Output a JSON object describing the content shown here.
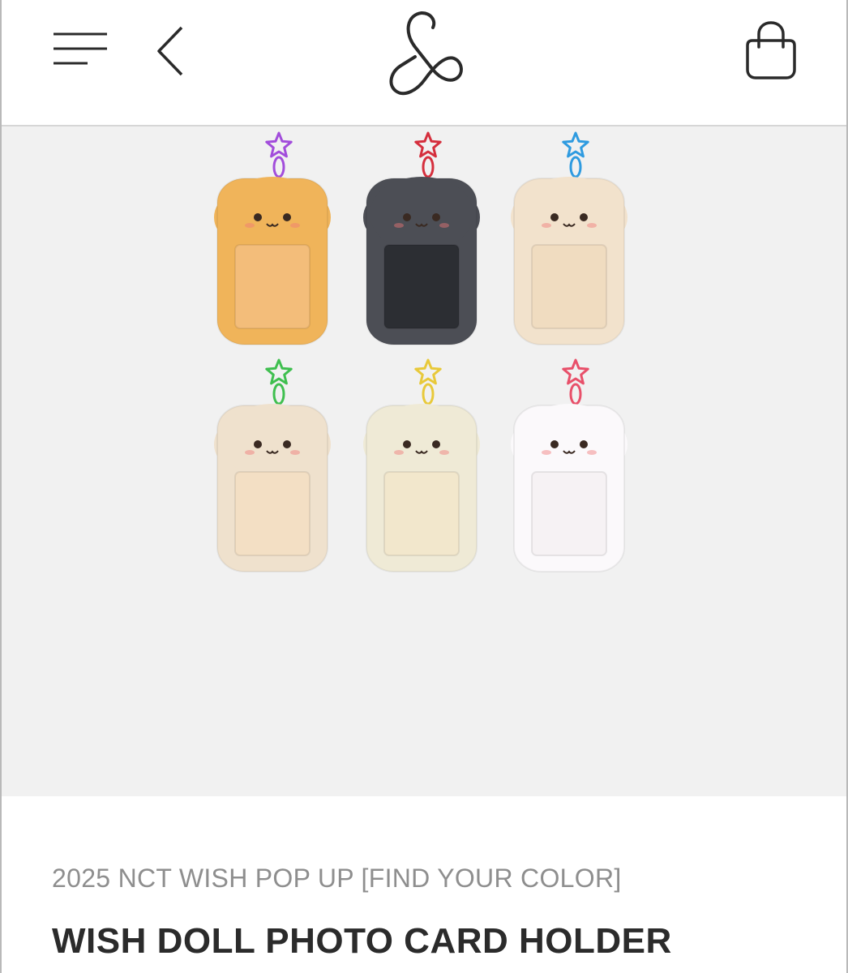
{
  "header": {
    "menu_icon": "hamburger-menu-icon",
    "back_icon": "chevron-left-icon",
    "logo": "ampersand-logo",
    "cart_icon": "shopping-bag-icon"
  },
  "product": {
    "collection": "2025 NCT WISH POP UP [FIND YOUR COLOR]",
    "title": "WISH DOLL PHOTO CARD HOLDER",
    "image": {
      "background": "#f1f1f1",
      "holders": [
        {
          "name": "orange-cat-holder",
          "fur": "#f0b45a",
          "window": "#f3bd7a",
          "star": "#a24ddb"
        },
        {
          "name": "gray-cat-holder",
          "fur": "#4c4e55",
          "window": "#2c2e33",
          "star": "#d52f3d"
        },
        {
          "name": "cream-orange-holder",
          "fur": "#f2e2cc",
          "window": "#f0dcc0",
          "star": "#2f9be0"
        },
        {
          "name": "beige-puppy-holder",
          "fur": "#efe1cd",
          "window": "#f3dfc4",
          "star": "#3fbf4f"
        },
        {
          "name": "ivory-puppy-holder",
          "fur": "#efead6",
          "window": "#f2e7cc",
          "star": "#e8c93a"
        },
        {
          "name": "white-bunny-holder",
          "fur": "#fbf9fb",
          "window": "#f6f2f4",
          "star": "#e8506a"
        }
      ]
    }
  }
}
